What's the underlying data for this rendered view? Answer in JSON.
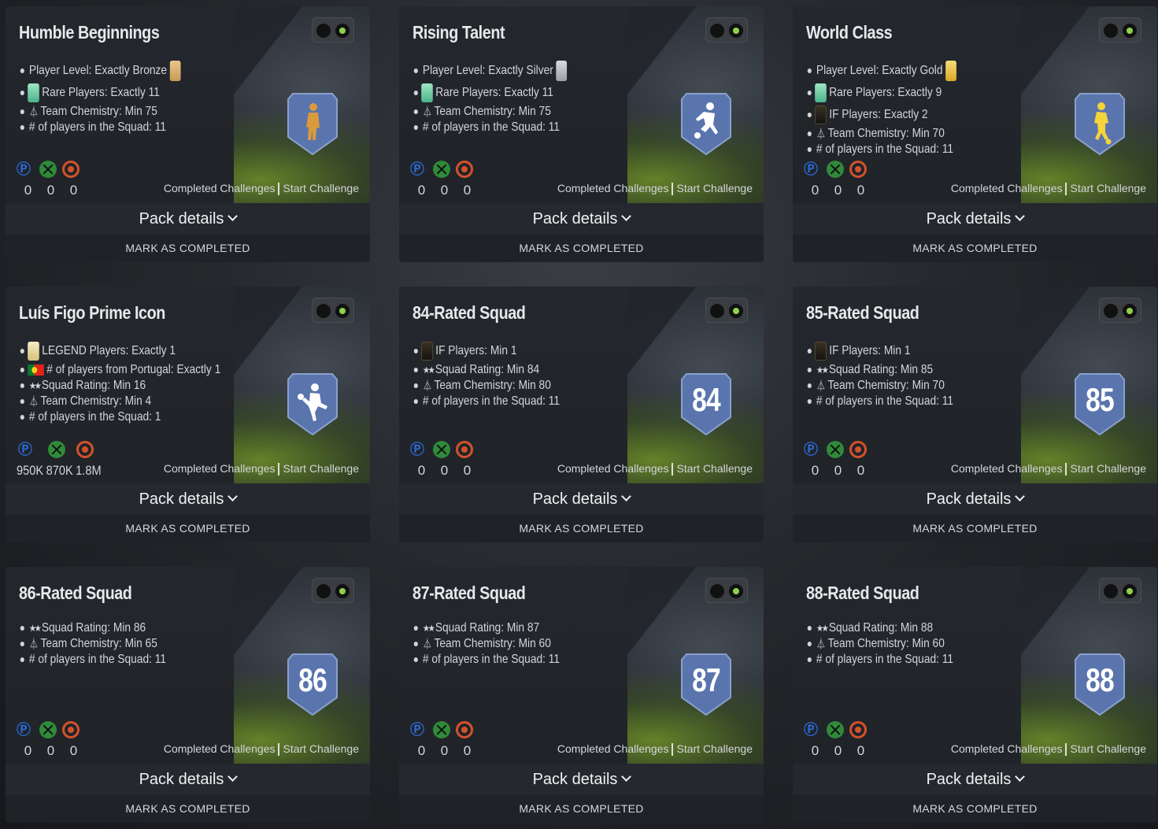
{
  "common": {
    "completed_label": "Completed Challenges",
    "start_label": "Start Challenge",
    "pack_label": "Pack details",
    "mark_label": "MARK AS COMPLETED",
    "platform_icons": [
      "playstation-icon",
      "xbox-icon",
      "origin-icon"
    ]
  },
  "cards": [
    {
      "title": "Humble Beginnings",
      "reqs": [
        "Player Level: Exactly Bronze",
        "Rare Players: Exactly 11",
        "Team Chemistry: Min 75",
        "# of players in the Squad: 11"
      ],
      "badge": "figure",
      "prices": [
        "0",
        "0",
        "0"
      ]
    },
    {
      "title": "Rising Talent",
      "reqs": [
        "Player Level: Exactly Silver",
        "Rare Players: Exactly 11",
        "Team Chemistry: Min 75",
        "# of players in the Squad: 11"
      ],
      "badge": "figure",
      "prices": [
        "0",
        "0",
        "0"
      ]
    },
    {
      "title": "World Class",
      "reqs": [
        "Player Level: Exactly Gold",
        "Rare Players: Exactly 9",
        "IF Players: Exactly 2",
        "Team Chemistry: Min 70",
        "# of players in the Squad: 11"
      ],
      "badge": "figure",
      "prices": [
        "0",
        "0",
        "0"
      ]
    },
    {
      "title": "Luís Figo Prime Icon",
      "reqs": [
        "LEGEND Players: Exactly 1",
        "# of players from Portugal: Exactly 1",
        "Squad Rating: Min 16",
        "Team Chemistry: Min 4",
        "# of players in the Squad: 1"
      ],
      "badge": "figure",
      "prices": [
        "950K",
        "870K",
        "1.8M"
      ]
    },
    {
      "title": "84-Rated Squad",
      "reqs": [
        "IF Players: Min 1",
        "Squad Rating: Min 84",
        "Team Chemistry: Min 80",
        "# of players in the Squad: 11"
      ],
      "badge": "84",
      "prices": [
        "0",
        "0",
        "0"
      ]
    },
    {
      "title": "85-Rated Squad",
      "reqs": [
        "IF Players: Min 1",
        "Squad Rating: Min 85",
        "Team Chemistry: Min 70",
        "# of players in the Squad: 11"
      ],
      "badge": "85",
      "prices": [
        "0",
        "0",
        "0"
      ]
    },
    {
      "title": "86-Rated Squad",
      "reqs": [
        "Squad Rating: Min 86",
        "Team Chemistry: Min 65",
        "# of players in the Squad: 11"
      ],
      "badge": "86",
      "prices": [
        "0",
        "0",
        "0"
      ]
    },
    {
      "title": "87-Rated Squad",
      "reqs": [
        "Squad Rating: Min 87",
        "Team Chemistry: Min 60",
        "# of players in the Squad: 11"
      ],
      "badge": "87",
      "prices": [
        "0",
        "0",
        "0"
      ]
    },
    {
      "title": "88-Rated Squad",
      "reqs": [
        "Squad Rating: Min 88",
        "Team Chemistry: Min 60",
        "# of players in the Squad: 11"
      ],
      "badge": "88",
      "prices": [
        "0",
        "0",
        "0"
      ]
    }
  ]
}
